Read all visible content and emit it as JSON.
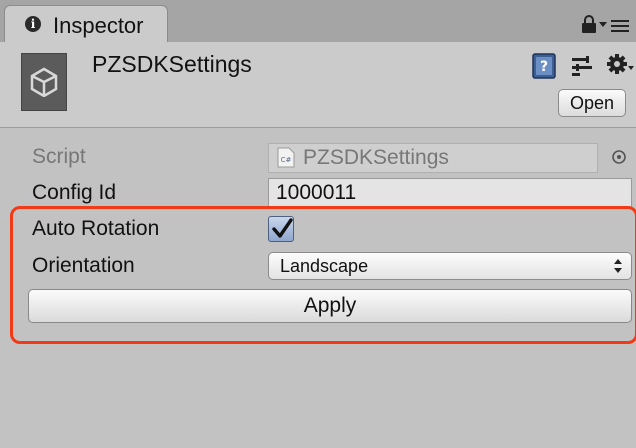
{
  "tab": {
    "icon": "info-icon",
    "label": "Inspector"
  },
  "tab_bar": {
    "lock_icon": "lock-icon",
    "menu_icon": "panel-menu-icon"
  },
  "header": {
    "thumbnail_icon": "unity-logo-icon",
    "title": "PZSDKSettings",
    "open_label": "Open",
    "icons": [
      "help-book-icon",
      "preset-icon",
      "gear-icon"
    ]
  },
  "fields": {
    "script": {
      "label": "Script",
      "value": "PZSDKSettings",
      "icon": "csharp-script-icon",
      "file_type": "C#"
    },
    "config_id": {
      "label": "Config Id",
      "value": "1000011"
    },
    "auto_rotation": {
      "label": "Auto Rotation",
      "checked": true
    },
    "orientation": {
      "label": "Orientation",
      "selected": "Landscape"
    }
  },
  "apply_label": "Apply",
  "colors": {
    "highlight": "#f33a17",
    "checkbox_fill": "#8fa6cd",
    "panel_bg": "#c2c2c2"
  }
}
